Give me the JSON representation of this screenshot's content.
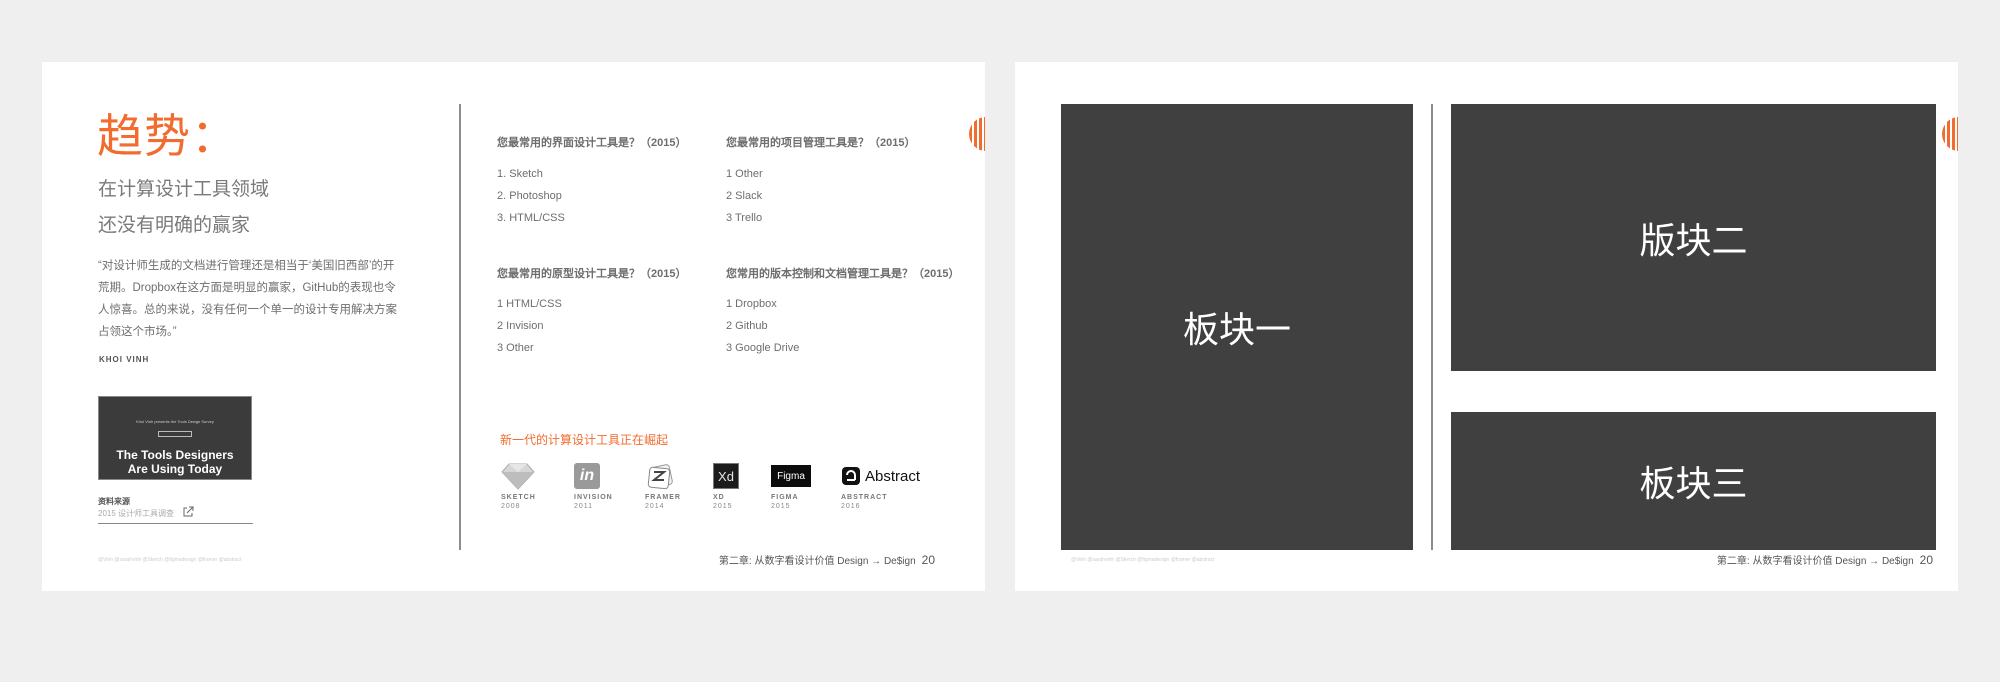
{
  "slide1": {
    "title": "趋势：",
    "subtitle_line1": "在计算设计工具领域",
    "subtitle_line2": "还没有明确的赢家",
    "quote": "“对设计师生成的文档进行管理还是相当于‘美国旧西部’的开荒期。Dropbox在这方面是明显的赢家，GitHub的表现也令人惊喜。总的来说，没有任何一个单一的设计专用解决方案占领这个市场。”",
    "author": "KHOI VINH",
    "cover": {
      "small_text": "Khoi Vinh presents the Tools Design Survey",
      "title_line1": "The Tools Designers",
      "title_line2": "Are Using Today"
    },
    "source_label": "资料来源",
    "source_link": "2015 设计师工具调查",
    "footnote": "@Vinh @sarahvinh @Sketch @figmadesign @framer @abstract",
    "surveys": [
      {
        "question": "您最常用的界面设计工具是？（2015）",
        "answers": [
          "1.  Sketch",
          "2.  Photoshop",
          "3.  HTML/CSS"
        ]
      },
      {
        "question": "您最常用的项目管理工具是？（2015）",
        "answers": [
          "1 Other",
          "2 Slack",
          "3 Trello"
        ]
      },
      {
        "question": "您最常用的原型设计工具是？（2015）",
        "answers": [
          "1 HTML/CSS",
          "2 Invision",
          "3 Other"
        ]
      },
      {
        "question": "您常用的版本控制和文档管理工具是？（2015）",
        "answers": [
          "1 Dropbox",
          "2 Github",
          "3 Google Drive"
        ]
      }
    ],
    "new_gen_label": "新一代的计算设计工具正在崛起",
    "tools": [
      {
        "name": "SKETCH",
        "year": "2008",
        "icon": "sketch-diamond-icon"
      },
      {
        "name": "INVISION",
        "year": "2011",
        "icon": "invision-icon",
        "glyph": "in"
      },
      {
        "name": "FRAMER",
        "year": "2014",
        "icon": "framer-icon"
      },
      {
        "name": "XD",
        "year": "2015",
        "icon": "xd-icon",
        "glyph": "Xd"
      },
      {
        "name": "FIGMA",
        "year": "2015",
        "icon": "figma-icon",
        "glyph": "Figma"
      },
      {
        "name": "ABSTRACT",
        "year": "2016",
        "icon": "abstract-icon",
        "glyph": "Abstract"
      }
    ],
    "footer_text": "第二章: 从数字看设计价值 Design → De$ign",
    "page_number": "20"
  },
  "slide2": {
    "block1": "板块一",
    "block2": "版块二",
    "block3": "板块三",
    "footnote": "@Vinh @sarahvinh @Sketch @figmadesign @framer @abstract",
    "footer_text": "第二章: 从数字看设计价值 Design → De$ign",
    "page_number": "20"
  },
  "colors": {
    "accent": "#f26b2f",
    "block": "#404040",
    "background": "#efefef"
  }
}
